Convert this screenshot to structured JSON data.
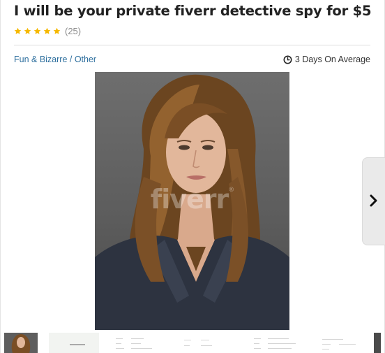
{
  "gig": {
    "title": "I will be your private fiverr detective spy for $5",
    "rating_count": "(25)",
    "stars": 5,
    "category": "Fun & Bizarre / Other",
    "delivery": "3 Days On Average"
  },
  "gallery": {
    "watermark": "fiverr",
    "watermark_mark": "®",
    "thumbnail_count": 7
  },
  "icons": {
    "star": "star-icon",
    "clock": "clock-icon",
    "next": "chevron-right-icon"
  },
  "colors": {
    "star": "#f5b800",
    "link": "#2e6f9e",
    "title": "#222222"
  }
}
